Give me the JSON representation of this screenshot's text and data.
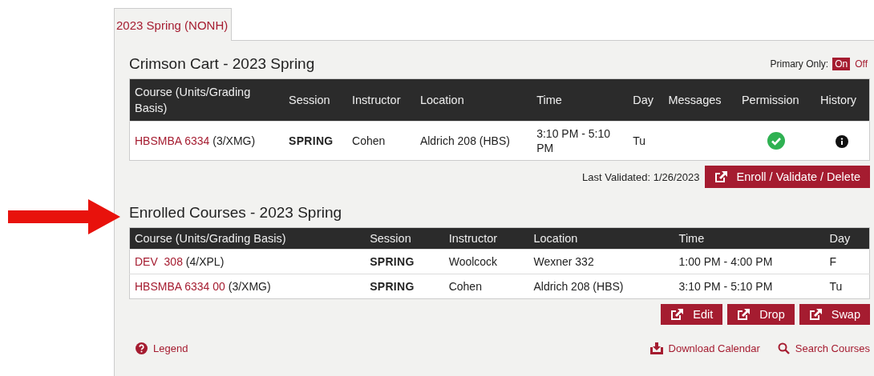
{
  "tabs": [
    {
      "label": "2023 Spring (NONH)",
      "selected": true
    }
  ],
  "cart": {
    "title": "Crimson Cart - 2023 Spring",
    "primary_only": {
      "label": "Primary Only:",
      "options": [
        {
          "label": "On",
          "selected": true
        },
        {
          "label": "Off",
          "selected": false
        }
      ]
    },
    "columns": [
      "Course (Units/Grading Basis)",
      "Session",
      "Instructor",
      "Location",
      "Time",
      "Day",
      "Messages",
      "Permission",
      "History"
    ],
    "rows": [
      {
        "course": "HBSMBA 6334",
        "units": "(3/XMG)",
        "session": "SPRING",
        "instructor": "Cohen",
        "location": "Aldrich 208 (HBS)",
        "time": "3:10 PM - 5:10 PM",
        "day": "Tu",
        "permission": true,
        "history": true
      }
    ],
    "last_validated": "Last Validated: 1/26/2023",
    "action": "Enroll / Validate / Delete"
  },
  "enrolled": {
    "title": "Enrolled Courses - 2023 Spring",
    "columns": [
      "Course (Units/Grading Basis)",
      "Session",
      "Instructor",
      "Location",
      "Time",
      "Day"
    ],
    "rows": [
      {
        "course": "DEV  308",
        "units": "(4/XPL)",
        "session": "SPRING",
        "instructor": "Woolcock",
        "location": "Wexner 332",
        "time": "1:00 PM - 4:00 PM",
        "day": "F"
      },
      {
        "course": "HBSMBA 6334 00",
        "units": "(3/XMG)",
        "session": "SPRING",
        "instructor": "Cohen",
        "location": "Aldrich 208 (HBS)",
        "time": "3:10 PM - 5:10 PM",
        "day": "Tu"
      }
    ],
    "actions": [
      "Edit",
      "Drop",
      "Swap"
    ]
  },
  "footer": {
    "legend": "Legend",
    "links": [
      {
        "kind": "download",
        "label": "Download Calendar"
      },
      {
        "kind": "search",
        "label": "Search Courses"
      }
    ]
  }
}
